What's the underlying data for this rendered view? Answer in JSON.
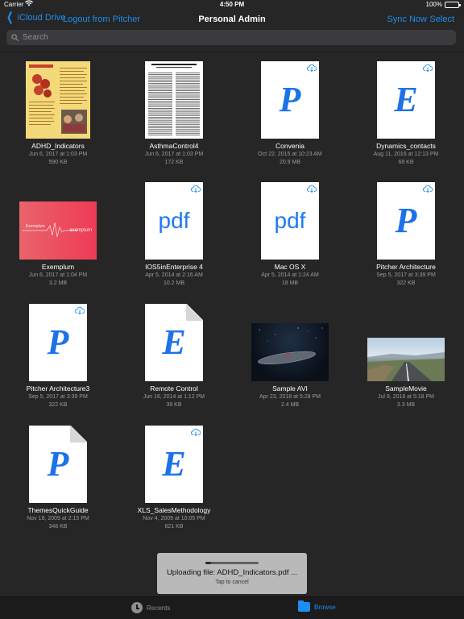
{
  "status_bar": {
    "carrier": "Carrier",
    "time": "4:50 PM",
    "battery": "100%"
  },
  "nav": {
    "back_label": "iCloud Drive",
    "logout_label": "Logout from Pitcher",
    "title": "Personal Admin",
    "sync_label": "Sync Now",
    "select_label": "Select"
  },
  "search": {
    "placeholder": "Search"
  },
  "files": [
    {
      "name": "ADHD_Indicators",
      "date": "Jun 6, 2017 at 1:03 PM",
      "size": "590 KB",
      "thumb": "flyer",
      "cloud": false
    },
    {
      "name": "AsthmaControl4",
      "date": "Jun 6, 2017 at 1:03 PM",
      "size": "172 KB",
      "thumb": "paper",
      "cloud": false
    },
    {
      "name": "Convenia",
      "date": "Oct 22, 2015 at 10:23 AM",
      "size": "20.9 MB",
      "thumb": "glyph",
      "glyph": "P",
      "cloud": true
    },
    {
      "name": "Dynamics_contacts",
      "date": "Aug 11, 2016 at 12:13 PM",
      "size": "68 KB",
      "thumb": "glyph",
      "glyph": "E",
      "cloud": true
    },
    {
      "name": "Exemplum",
      "date": "Jun 6, 2017 at 1:04 PM",
      "size": "3.2 MB",
      "thumb": "wave",
      "cloud": false
    },
    {
      "name": "IOS5inEnterprise 4",
      "date": "Apr 5, 2014 at 2:16 AM",
      "size": "10.2 MB",
      "thumb": "pdf",
      "glyph": "pdf",
      "cloud": true
    },
    {
      "name": "Mac OS X",
      "date": "Apr 5, 2014 at 1:24 AM",
      "size": "18 MB",
      "thumb": "pdf",
      "glyph": "pdf",
      "cloud": true
    },
    {
      "name": "Pitcher Architecture",
      "date": "Sep 5, 2017 at 3:39 PM",
      "size": "322 KB",
      "thumb": "glyph",
      "glyph": "P",
      "cloud": true
    },
    {
      "name": "Pitcher Architecture3",
      "date": "Sep 5, 2017 at 3:39 PM",
      "size": "322 KB",
      "thumb": "glyph",
      "glyph": "P",
      "cloud": true
    },
    {
      "name": "Remote Control",
      "date": "Jun 16, 2014 at 1:12 PM",
      "size": "39 KB",
      "thumb": "fold",
      "glyph": "E",
      "cloud": false
    },
    {
      "name": "Sample AVI",
      "date": "Apr 23, 2018 at 5:28 PM",
      "size": "2.4 MB",
      "thumb": "video1",
      "cloud": false
    },
    {
      "name": "SampleMovie",
      "date": "Jul 9, 2016 at 5:18 PM",
      "size": "3.3 MB",
      "thumb": "video2",
      "cloud": false
    },
    {
      "name": "ThemesQuickGuide",
      "date": "Nov 18, 2009 at 2:15 PM",
      "size": "348 KB",
      "thumb": "fold",
      "glyph": "P",
      "cloud": false
    },
    {
      "name": "XLS_SalesMethodology",
      "date": "Nov 4, 2009 at 10:05 PM",
      "size": "621 KB",
      "thumb": "glyph",
      "glyph": "E",
      "cloud": true
    }
  ],
  "wave_thumb": {
    "left_text": "Exemplum",
    "right_text": "exemplum"
  },
  "upload_toast": {
    "message": "Uploading file: ADHD_Indicators.pdf ...",
    "sub": "Tap to cancel",
    "progress": 0.1
  },
  "tabs": {
    "recents": "Recents",
    "browse": "Browse"
  },
  "colors": {
    "accent": "#1c8ef0",
    "background": "#262626",
    "doc_glyph": "#1d72e8"
  }
}
